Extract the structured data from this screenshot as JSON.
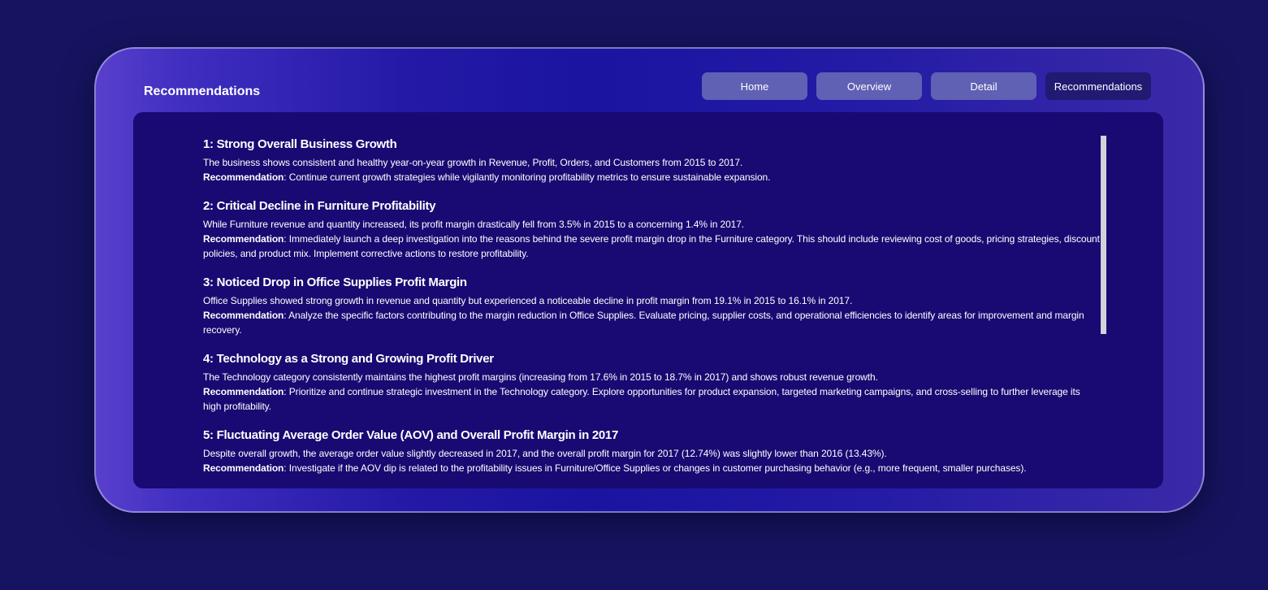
{
  "header": {
    "title": "Recommendations"
  },
  "nav": {
    "buttons": [
      {
        "label": "Home"
      },
      {
        "label": "Overview"
      },
      {
        "label": "Detail"
      },
      {
        "label": "Recommendations",
        "active": true
      }
    ]
  },
  "recommendations": [
    {
      "title": "1: Strong Overall Business Growth",
      "finding": "The business shows consistent and healthy year-on-year growth in Revenue, Profit, Orders, and Customers from 2015 to 2017.",
      "rec_label": "Recommendation",
      "rec_text": ": Continue current growth strategies while vigilantly monitoring profitability metrics to ensure sustainable expansion."
    },
    {
      "title": "2: Critical Decline in Furniture Profitability",
      "finding": "While Furniture revenue and quantity increased, its profit margin drastically fell from 3.5% in 2015 to a concerning 1.4% in 2017.",
      "rec_label": "Recommendation",
      "rec_text": ": Immediately launch a deep investigation into the reasons behind the severe profit margin drop in the Furniture category. This should include reviewing cost of goods, pricing strategies, discount policies, and product mix. Implement corrective actions to restore profitability."
    },
    {
      "title": "3: Noticed Drop in Office Supplies Profit Margin",
      "finding": "Office Supplies showed strong growth in revenue and quantity but experienced a noticeable decline in profit margin from 19.1% in 2015 to 16.1% in 2017.",
      "rec_label": "Recommendation",
      "rec_text": ": Analyze the specific factors contributing to the margin reduction in Office Supplies. Evaluate pricing, supplier costs, and operational efficiencies to identify areas for improvement and margin recovery."
    },
    {
      "title": "4: Technology as a Strong and Growing Profit Driver",
      "finding": "The Technology category consistently maintains the highest profit margins (increasing from 17.6% in 2015 to 18.7% in 2017) and shows robust revenue growth.",
      "rec_label": "Recommendation",
      "rec_text": ": Prioritize and continue strategic investment in the Technology category. Explore opportunities for product expansion, targeted marketing campaigns, and cross-selling to further leverage its high profitability."
    },
    {
      "title": "5: Fluctuating Average Order Value (AOV) and Overall Profit Margin in 2017",
      "finding": "Despite overall growth, the average order value slightly decreased in 2017, and the overall profit margin for 2017 (12.74%) was slightly lower than 2016 (13.43%).",
      "rec_label": "Recommendation",
      "rec_text": ": Investigate if the AOV dip is related to the profitability issues in Furniture/Office Supplies or changes in customer purchasing behavior (e.g., more frequent, smaller purchases)."
    }
  ],
  "colors": {
    "page_bg": "#161460",
    "panel_bg": "#180a72",
    "button_bg": "#6060b4",
    "button_active_bg": "#201a72",
    "scrollbar": "#d2d2da"
  }
}
